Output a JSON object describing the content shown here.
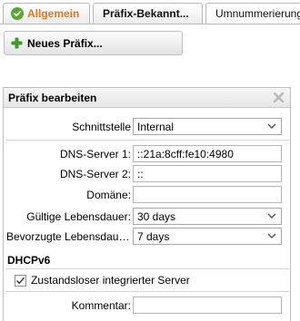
{
  "tabs": [
    {
      "label": "Allgemein"
    },
    {
      "label": "Präfix-Bekannt..."
    },
    {
      "label": "Umnummerierung"
    }
  ],
  "toolbar": {
    "new_prefix_label": "Neues Präfix..."
  },
  "dialog": {
    "title": "Präfix bearbeiten",
    "fields": {
      "interface": {
        "label": "Schnittstelle",
        "value": "Internal"
      },
      "dns1": {
        "label": "DNS-Server 1:",
        "value": "::21a:8cff:fe10:4980"
      },
      "dns2": {
        "label": "DNS-Server 2:",
        "value": "::"
      },
      "domain": {
        "label": "Domäne:",
        "value": ""
      },
      "valid_lifetime": {
        "label": "Gültige Lebensdauer:",
        "value": "30 days"
      },
      "preferred_lifetime": {
        "label": "Bevorzugte Lebensdauer:",
        "value": "7 days"
      }
    },
    "dhcp_section": {
      "title": "DHCPv6",
      "stateless_label": "Zustandsloser integrierter Server",
      "stateless_checked": true
    },
    "comment": {
      "label": "Kommentar:",
      "value": ""
    }
  },
  "colors": {
    "active_tab_text": "#e8771a",
    "check_green": "#5ba82e",
    "plus_green": "#3f9a2a"
  }
}
